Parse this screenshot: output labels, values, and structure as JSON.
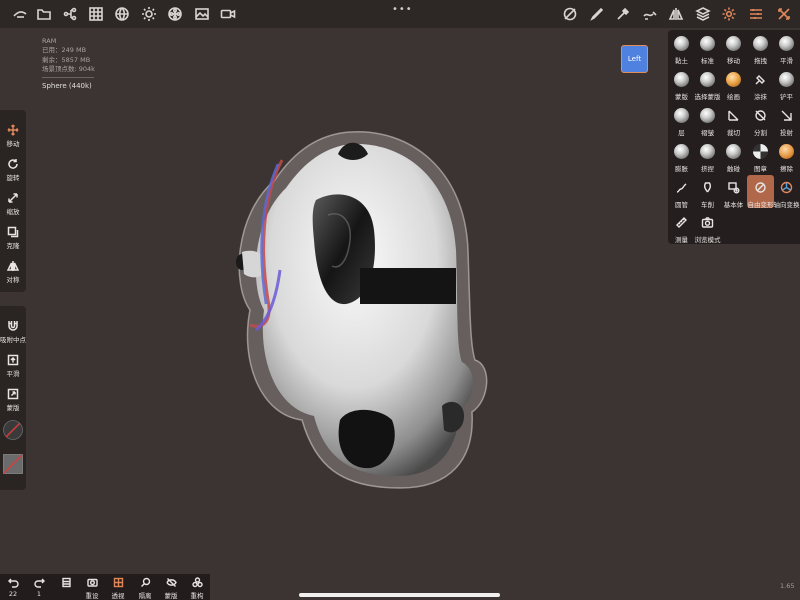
{
  "stats": {
    "ram_label": "RAM",
    "used": "已用：249 MB",
    "free": "剩余：5857 MB",
    "vertices": "场景顶点数: 904k",
    "object": "Sphere (440k)"
  },
  "topbar": {
    "left_icons": [
      "logo-icon",
      "folder-icon",
      "scene-tree-icon",
      "grid-icon",
      "globe-icon",
      "sun-icon",
      "film-reel-icon",
      "image-icon",
      "video-camera-icon"
    ],
    "right_icons": [
      "selection-icon",
      "brush-icon",
      "pipette-icon",
      "stroke-icon",
      "mirror-icon",
      "layers-icon",
      "settings-icon",
      "tools-menu-icon",
      "cross-tools-icon"
    ],
    "more_dots": "•••"
  },
  "view_cube": {
    "label": "Left"
  },
  "left_toolbar": [
    {
      "label": "移动"
    },
    {
      "label": "旋转"
    },
    {
      "label": "缩放"
    },
    {
      "label": "克隆"
    },
    {
      "label": "对称"
    }
  ],
  "left_toolbar2": [
    {
      "label": "吸附中点"
    },
    {
      "label": "平滑"
    },
    {
      "label": "蒙版"
    }
  ],
  "tools": [
    {
      "label": "黏土"
    },
    {
      "label": "标准"
    },
    {
      "label": "移动"
    },
    {
      "label": "拖拽"
    },
    {
      "label": "平滑"
    },
    {
      "label": "蒙版"
    },
    {
      "label": "选择蒙版"
    },
    {
      "label": "绘画"
    },
    {
      "label": "涂抹"
    },
    {
      "label": "铲平"
    },
    {
      "label": "层"
    },
    {
      "label": "褶皱"
    },
    {
      "label": "裁切"
    },
    {
      "label": "分割"
    },
    {
      "label": "投射"
    },
    {
      "label": "膨胀"
    },
    {
      "label": "挤捏"
    },
    {
      "label": "触碰"
    },
    {
      "label": "图章"
    },
    {
      "label": "擦除"
    },
    {
      "label": "圆管"
    },
    {
      "label": "车削"
    },
    {
      "label": "基本体"
    },
    {
      "label": "自由变形"
    },
    {
      "label": "轴向变换"
    },
    {
      "label": "测量"
    },
    {
      "label": "浏览模式"
    }
  ],
  "bottom_toolbar": [
    {
      "label": "22"
    },
    {
      "label": "1"
    },
    {
      "label": ""
    },
    {
      "label": "重设"
    },
    {
      "label": "透视"
    },
    {
      "label": "隔离"
    },
    {
      "label": "蒙版"
    },
    {
      "label": "重构"
    }
  ],
  "fps": "1.65",
  "colors": {
    "accent": "#e0875a",
    "selected_tool": "#b0674a",
    "view_cube": "#4f82e0"
  }
}
